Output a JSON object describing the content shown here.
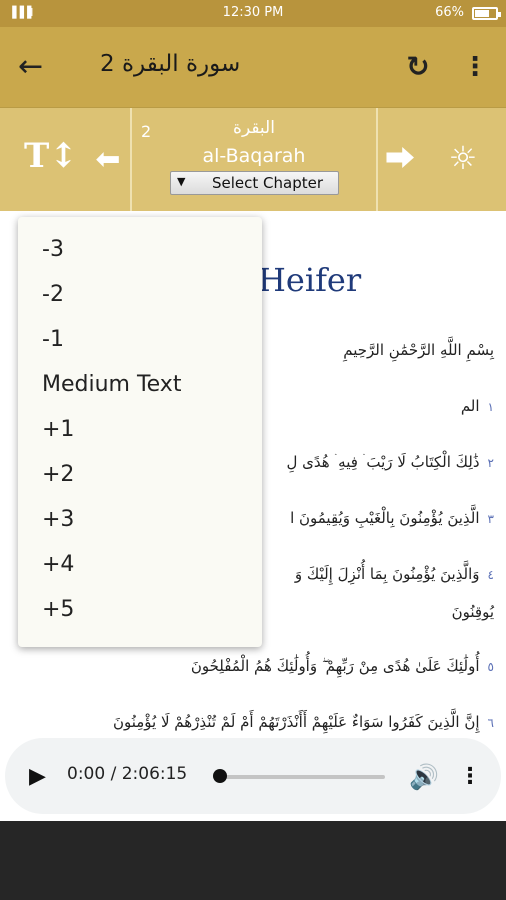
{
  "status_bar": {
    "signal": "▐▐▐l",
    "time": "12:30 PM",
    "battery": "66%"
  },
  "app_bar": {
    "back_icon": "arrow-left-icon",
    "back_glyph": "←",
    "title": "2 سورة البقرة",
    "refresh_icon": "refresh-icon",
    "refresh_glyph": "↻",
    "more_icon": "more-vert-icon",
    "more_glyph": "⋮"
  },
  "chapter_nav": {
    "text_size_glyph": "T↕",
    "prev_glyph": "⬅",
    "next_glyph": "⮕",
    "theme_glyph": "☼",
    "chapter_number": "2",
    "arabic_name": "البقرة",
    "english_name": "al-Baqarah",
    "select_arrow": "▼",
    "select_label": "Select Chapter"
  },
  "content": {
    "heading_fragment": "Heifer",
    "bismillah": "بِسْمِ اللَّهِ الرَّحْمَٰنِ الرَّحِيمِ",
    "verses": [
      {
        "num": "١",
        "text": "الم"
      },
      {
        "num": "٢",
        "text": "ذَٰلِكَ الْكِتَابُ لَا رَيْبَ ۛ فِيهِ ۛ هُدًى لِ"
      },
      {
        "num": "٣",
        "text": "الَّذِينَ يُؤْمِنُونَ بِالْغَيْبِ وَيُقِيمُونَ ا"
      },
      {
        "num": "٤",
        "text": "وَالَّذِينَ يُؤْمِنُونَ بِمَا أُنْزِلَ إِلَيْكَ وَ",
        "cont": "يُوقِنُونَ"
      },
      {
        "num": "٥",
        "text": "أُولَٰئِكَ عَلَىٰ هُدًى مِنْ رَبِّهِمْ ۖ وَأُولَٰئِكَ هُمُ الْمُفْلِحُونَ"
      },
      {
        "num": "٦",
        "text": "إِنَّ الَّذِينَ كَفَرُوا سَوَاءٌ عَلَيْهِمْ أَأَنْذَرْتَهُمْ أَمْ لَمْ تُنْذِرْهُمْ لَا يُؤْمِنُونَ"
      }
    ]
  },
  "text_size_menu": {
    "options": [
      "-3",
      "-2",
      "-1",
      "Medium Text",
      "+1",
      "+2",
      "+3",
      "+4",
      "+5"
    ]
  },
  "audio_player": {
    "play_glyph": "▶",
    "time": "0:00 / 2:06:15",
    "progress": 0,
    "volume_glyph": "🔊",
    "more_glyph": "⋮"
  },
  "colors": {
    "app_bar": "#c9a84c",
    "toolbar": "#dcc274",
    "status_bar": "#b8943d",
    "heading": "#1f3a7a"
  }
}
